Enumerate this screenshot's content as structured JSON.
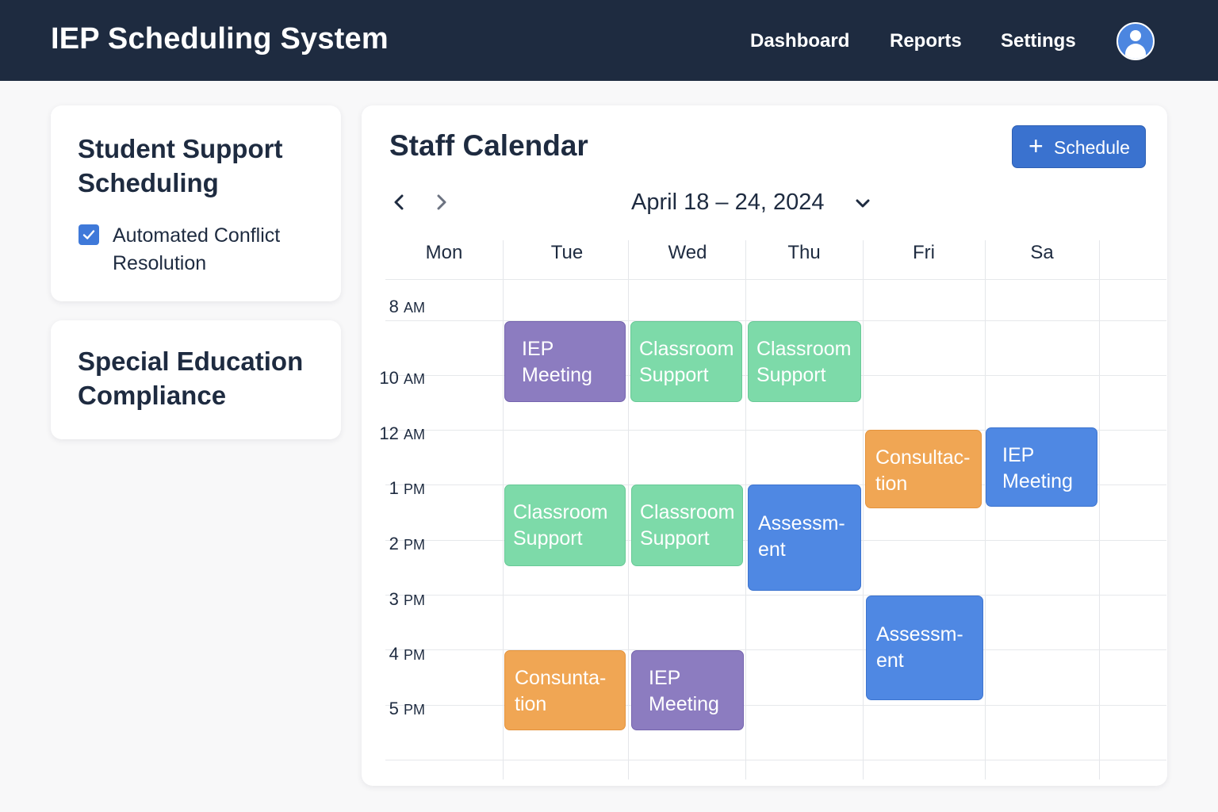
{
  "app": {
    "title": "IEP Scheduling System"
  },
  "nav": {
    "dashboard": "Dashboard",
    "reports": "Reports",
    "settings": "Settings"
  },
  "sidebar": {
    "card1": {
      "title": "Student Support Scheduling",
      "checkbox_label": "Automated Conflict Resolution",
      "checked": true
    },
    "card2": {
      "title": "Special Education Compliance"
    }
  },
  "calendar": {
    "title": "Staff Calendar",
    "schedule_button": "Schedule",
    "date_range": "April 18 – 24, 2024",
    "days": [
      "Mon",
      "Tue",
      "Wed",
      "Thu",
      "Fri",
      "Sa"
    ],
    "times": [
      {
        "num": "8",
        "ampm": "AM"
      },
      {
        "num": "10",
        "ampm": "AM"
      },
      {
        "num": "12",
        "ampm": "AM"
      },
      {
        "num": "1",
        "ampm": "PM"
      },
      {
        "num": "2",
        "ampm": "PM"
      },
      {
        "num": "3",
        "ampm": "PM"
      },
      {
        "num": "4",
        "ampm": "PM"
      },
      {
        "num": "5",
        "ampm": "PM"
      }
    ],
    "events": [
      {
        "day": "Tue",
        "line1": "IEP",
        "line2": "Meeting",
        "color": "#8c7cc0"
      },
      {
        "day": "Wed",
        "line1": "Classroom",
        "line2": "Support",
        "color": "#7ddaa9"
      },
      {
        "day": "Thu",
        "line1": "Classroom",
        "line2": "Support",
        "color": "#7ddaa9"
      },
      {
        "day": "Fri",
        "line1": "Consultac-",
        "line2": "tion",
        "color": "#f0a654"
      },
      {
        "day": "Sa",
        "line1": "IEP",
        "line2": "Meeting",
        "color": "#4f88e3"
      },
      {
        "day": "Tue",
        "line1": "Classroom",
        "line2": "Support",
        "color": "#7ddaa9"
      },
      {
        "day": "Wed",
        "line1": "Classroom",
        "line2": "Support",
        "color": "#7ddaa9"
      },
      {
        "day": "Thu",
        "line1": "Assessm-",
        "line2": "ent",
        "color": "#4f88e3"
      },
      {
        "day": "Fri",
        "line1": "Assessm-",
        "line2": "ent",
        "color": "#4f88e3"
      },
      {
        "day": "Tue",
        "line1": "Consunta-",
        "line2": "tion",
        "color": "#f0a654"
      },
      {
        "day": "Wed",
        "line1": "IEP",
        "line2": "Meeting",
        "color": "#8c7cc0"
      }
    ]
  },
  "icons": {
    "avatar": "user-avatar-icon",
    "prev": "chevron-left-icon",
    "next": "chevron-right-icon",
    "dropdown": "chevron-down-icon",
    "checkbox": "checkmark-icon",
    "add": "plus-icon"
  }
}
